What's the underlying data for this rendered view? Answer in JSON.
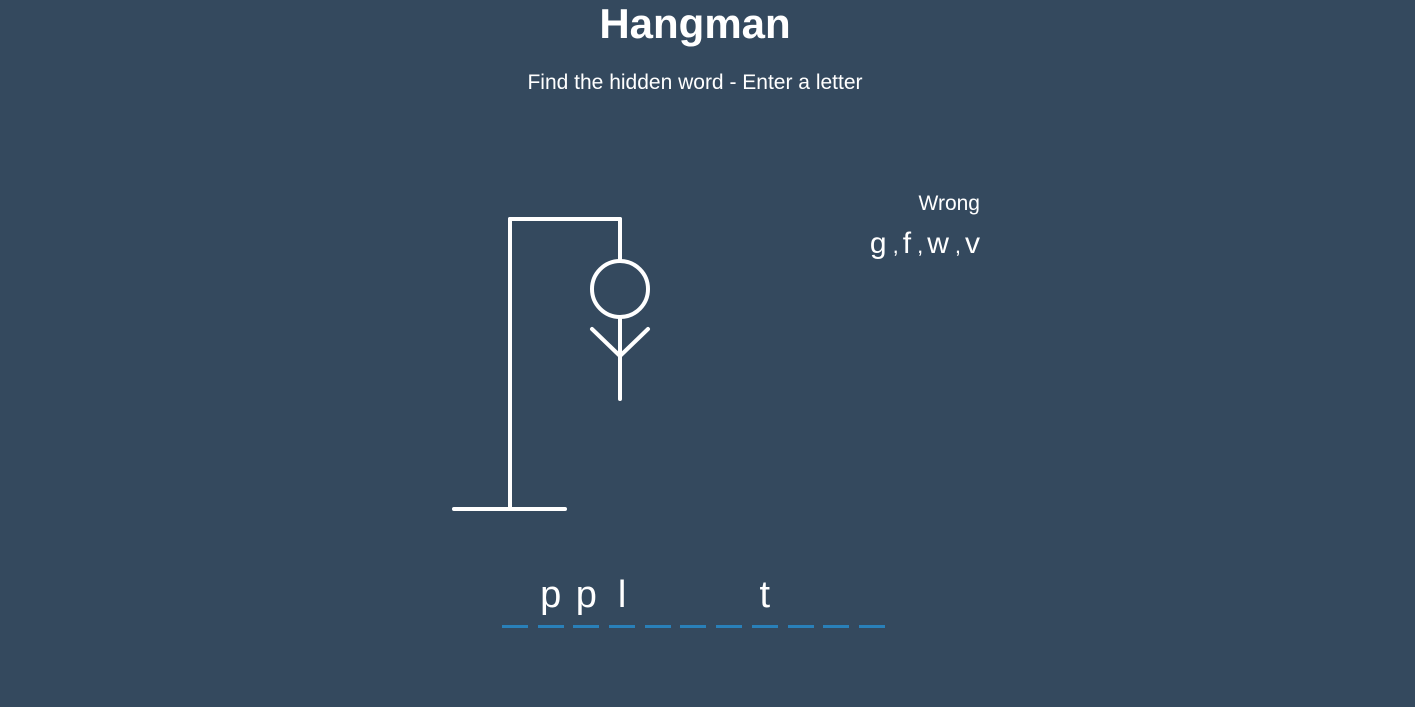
{
  "header": {
    "title": "Hangman",
    "subtitle": "Find the hidden word - Enter a letter"
  },
  "wrong": {
    "label": "Wrong",
    "letters": [
      "g",
      "f",
      "w",
      "v"
    ],
    "separator": ","
  },
  "word": {
    "slots": [
      "",
      "p",
      "p",
      "l",
      "",
      "",
      "",
      "t",
      "",
      "",
      "",
      ""
    ]
  },
  "figure": {
    "parts_shown": [
      "base",
      "pole",
      "beam",
      "rope",
      "head",
      "body",
      "left-arm",
      "right-arm"
    ]
  },
  "colors": {
    "background": "#34495e",
    "text": "#ffffff",
    "figure": "#ffffff",
    "underline": "#2980b9"
  }
}
